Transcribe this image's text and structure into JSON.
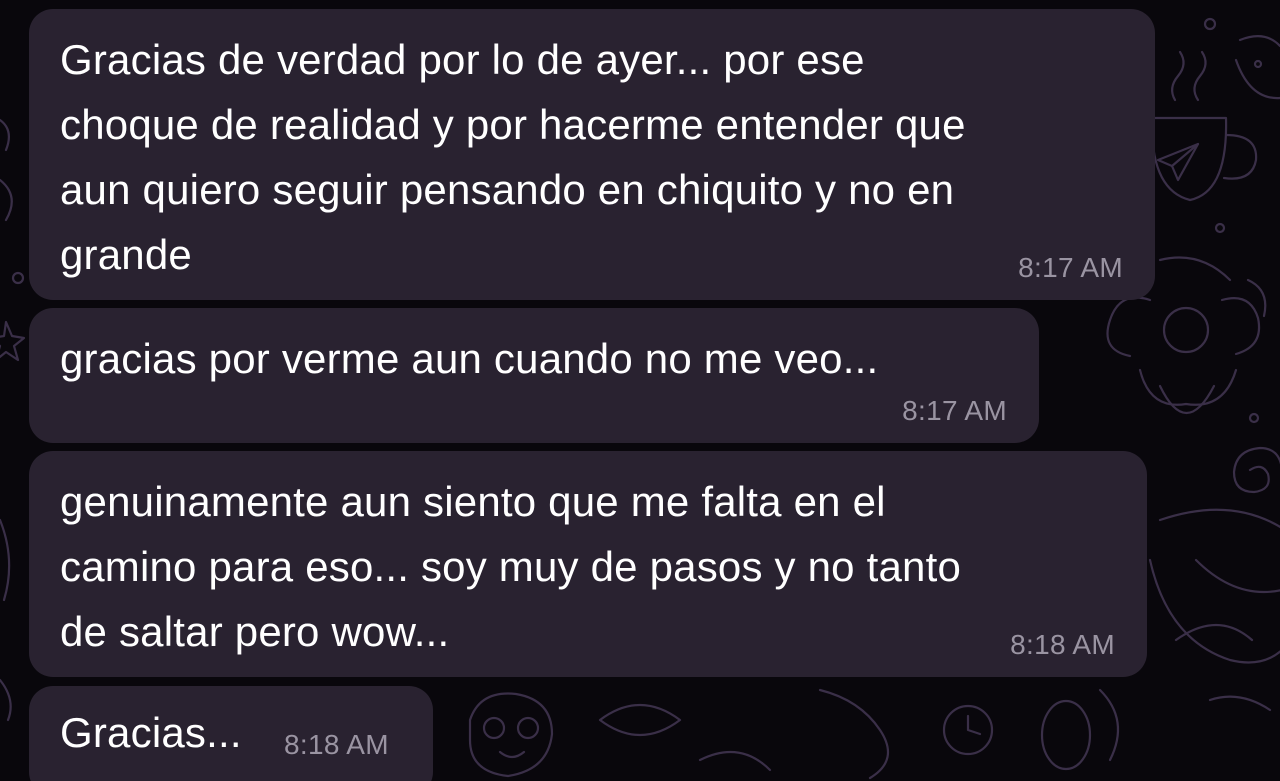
{
  "chat": {
    "messages": [
      {
        "lines": [
          "Gracias de verdad por lo de ayer... por ese",
          "choque de realidad y por hacerme entender que",
          "aun quiero seguir pensando en chiquito y no en",
          "grande"
        ],
        "time": "8:17 AM"
      },
      {
        "lines": [
          "gracias por verme aun cuando no me veo..."
        ],
        "time": "8:17 AM"
      },
      {
        "lines": [
          "genuinamente aun siento que me falta en el",
          "camino para eso... soy muy de pasos y no tanto",
          "de saltar pero wow..."
        ],
        "time": "8:18 AM"
      },
      {
        "lines": [
          "Gracias..."
        ],
        "time": "8:18 AM"
      }
    ]
  },
  "theme": {
    "background": "#09070c",
    "bubble": "#292230",
    "text": "#ffffff",
    "timestamp": "#9a94a2",
    "doodle": "#3a2f48"
  },
  "wallpaper": {
    "icons": [
      "coffee-cup-icon",
      "paper-plane-icon",
      "moon-icon",
      "star-icon",
      "flower-icon",
      "spiral-icon",
      "ghost-icon",
      "egg-icon",
      "bear-icon",
      "leaf-icon"
    ]
  }
}
